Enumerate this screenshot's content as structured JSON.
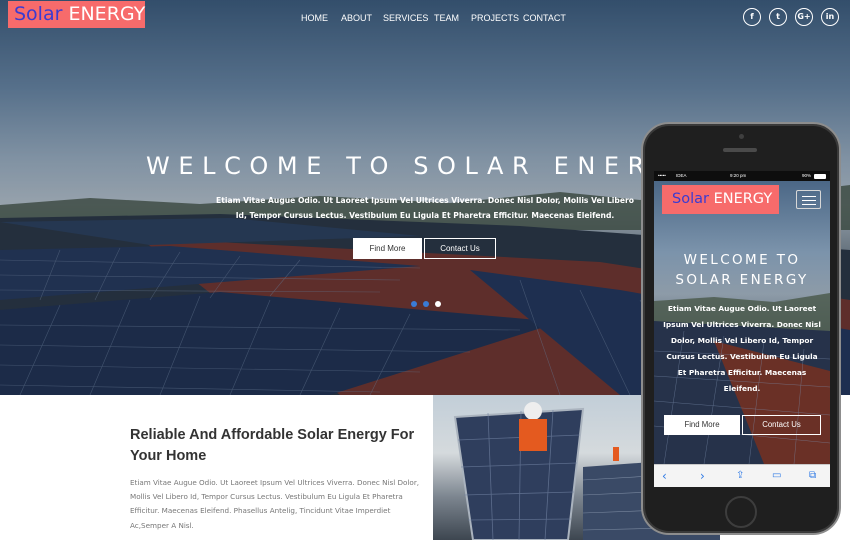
{
  "header": {
    "logo_part1": "Solar",
    "logo_part2": "ENERGY",
    "nav": [
      "HOME",
      "ABOUT",
      "SERVICES",
      "TEAM",
      "PROJECTS",
      "CONTACT"
    ],
    "social": [
      "f",
      "t",
      "G+",
      "in"
    ]
  },
  "hero": {
    "title": "WELCOME TO SOLAR ENERGY",
    "text": "Etiam Vitae Augue Odio. Ut Laoreet Ipsum Vel Ultrices Viverra. Donec Nisl Dolor, Mollis Vel Libero Id, Tempor Cursus Lectus. Vestibulum Eu Ligula Et Pharetra Efficitur. Maecenas Eleifend.",
    "find_more": "Find More",
    "contact_us": "Contact Us",
    "slides": 3,
    "active_slide": 3
  },
  "about": {
    "title": "Reliable And Affordable Solar Energy For Your Home",
    "text": "Etiam Vitae Augue Odio. Ut Laoreet Ipsum Vel Ultrices Viverra. Donec Nisl Dolor, Mollis Vel Libero Id, Tempor Cursus Lectus. Vestibulum Eu Ligula Et Pharetra Efficitur. Maecenas Eleifend. Phasellus Antelig, Tincidunt Vitae Imperdiet Ac,Semper A Nisl."
  },
  "phone": {
    "carrier": "IDEA",
    "time": "9:20 pm",
    "battery": "90%",
    "logo_part1": "Solar",
    "logo_part2": "ENERGY",
    "title": "WELCOME TO SOLAR ENERGY",
    "text": "Etiam Vitae Augue Odio. Ut Laoreet Ipsum Vel Ultrices Viverra. Donec Nisl Dolor, Mollis Vel Libero Id, Tempor Cursus Lectus. Vestibulum Eu Ligula Et Pharetra Efficitur. Maecenas Eleifend.",
    "find_more": "Find More",
    "contact_us": "Contact Us",
    "toolbar_icons": [
      "back-icon",
      "forward-icon",
      "share-icon",
      "bookmarks-icon",
      "tabs-icon"
    ]
  },
  "colors": {
    "logo_bg": "#f76b6b",
    "logo_solar": "#3b3bd1",
    "dot_active": "#ffffff",
    "dot_inactive": "#3a7bd5",
    "ios_blue": "#2f7ae5"
  }
}
